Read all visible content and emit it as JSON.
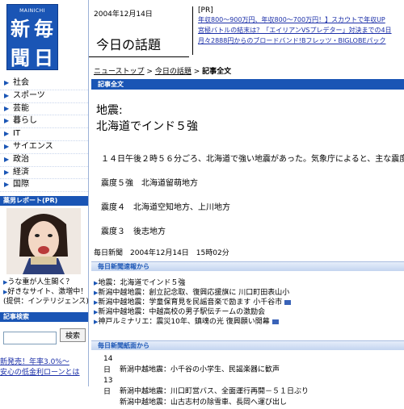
{
  "logo": {
    "sub": "MAINICHI",
    "kanji": [
      "新",
      "毎",
      "聞",
      "日"
    ]
  },
  "nav": {
    "items": [
      "社会",
      "スポーツ",
      "芸能",
      "暮らし",
      "IT",
      "サイエンス",
      "政治",
      "経済",
      "国際"
    ]
  },
  "promo": {
    "heading": "薬男レポート(PR)",
    "links": [
      "うな重が人生閣く？",
      "好きなサイト、激増中！",
      "(提供：インテリジェンス)"
    ]
  },
  "search": {
    "heading": "記事検索",
    "input_value": "",
    "button": "検索"
  },
  "bottom_links": [
    "新発売！年率3.0%〜",
    "安心の低金利ローンとは"
  ],
  "header": {
    "date": "2004年12月14日",
    "title": "今日の話題",
    "pr_label": "[PR]",
    "pr_ads": [
      "年収800〜900万円、年収800〜700万円！】スカウトで年収UP",
      "宮極バトルの結末は？「エイリアンVSプレデター」対決までの4日",
      "月々2888円からのブロードバンド!Bフレッツ・BIGLOBEパック"
    ]
  },
  "breadcrumb": {
    "items": [
      "ニューストップ",
      "今日の話題"
    ],
    "current": "記事全文",
    "sep": " > "
  },
  "article": {
    "bar_label": "記事全文",
    "heading1": "地震:",
    "heading2": "北海道でインド５強",
    "paragraph": "１４日午後２時５６分ごろ、北海道で強い地震があった。気象庁によると、主な震度",
    "lines": [
      "震度５強　北海道留萌地方",
      "震度４　北海道空知地方、上川地方",
      "震度３　後志地方"
    ],
    "meta": "毎日新聞　2004年12月14日　15時02分"
  },
  "flash": {
    "bar_label": "毎日新聞速報から",
    "items": [
      "地震：北海道でインド５強",
      "新潟中越地震：創立記念取、復興応援旗に 川口町田表山小",
      "新潟中越地震：学童保育見を民謡音楽で励ます 小千谷市",
      "新潟中越地震：中越高校の男子駅伝チームの激励会",
      "神戸ルミナリエ：震災10年、鎮魂の光 復興願い開幕"
    ]
  },
  "paper": {
    "bar_label": "毎日新聞紙面から",
    "rows": [
      {
        "date": "14日",
        "text": "新潟中越地震：小千谷の小学生、民謡楽器に歓声"
      },
      {
        "date": "13日",
        "text": "新潟中越地震：川口町営バス、全面運行再開－５１日ぶり"
      },
      {
        "date": "",
        "text": "新潟中越地震：山古志村の除雪車、長岡へ運び出し"
      }
    ]
  }
}
